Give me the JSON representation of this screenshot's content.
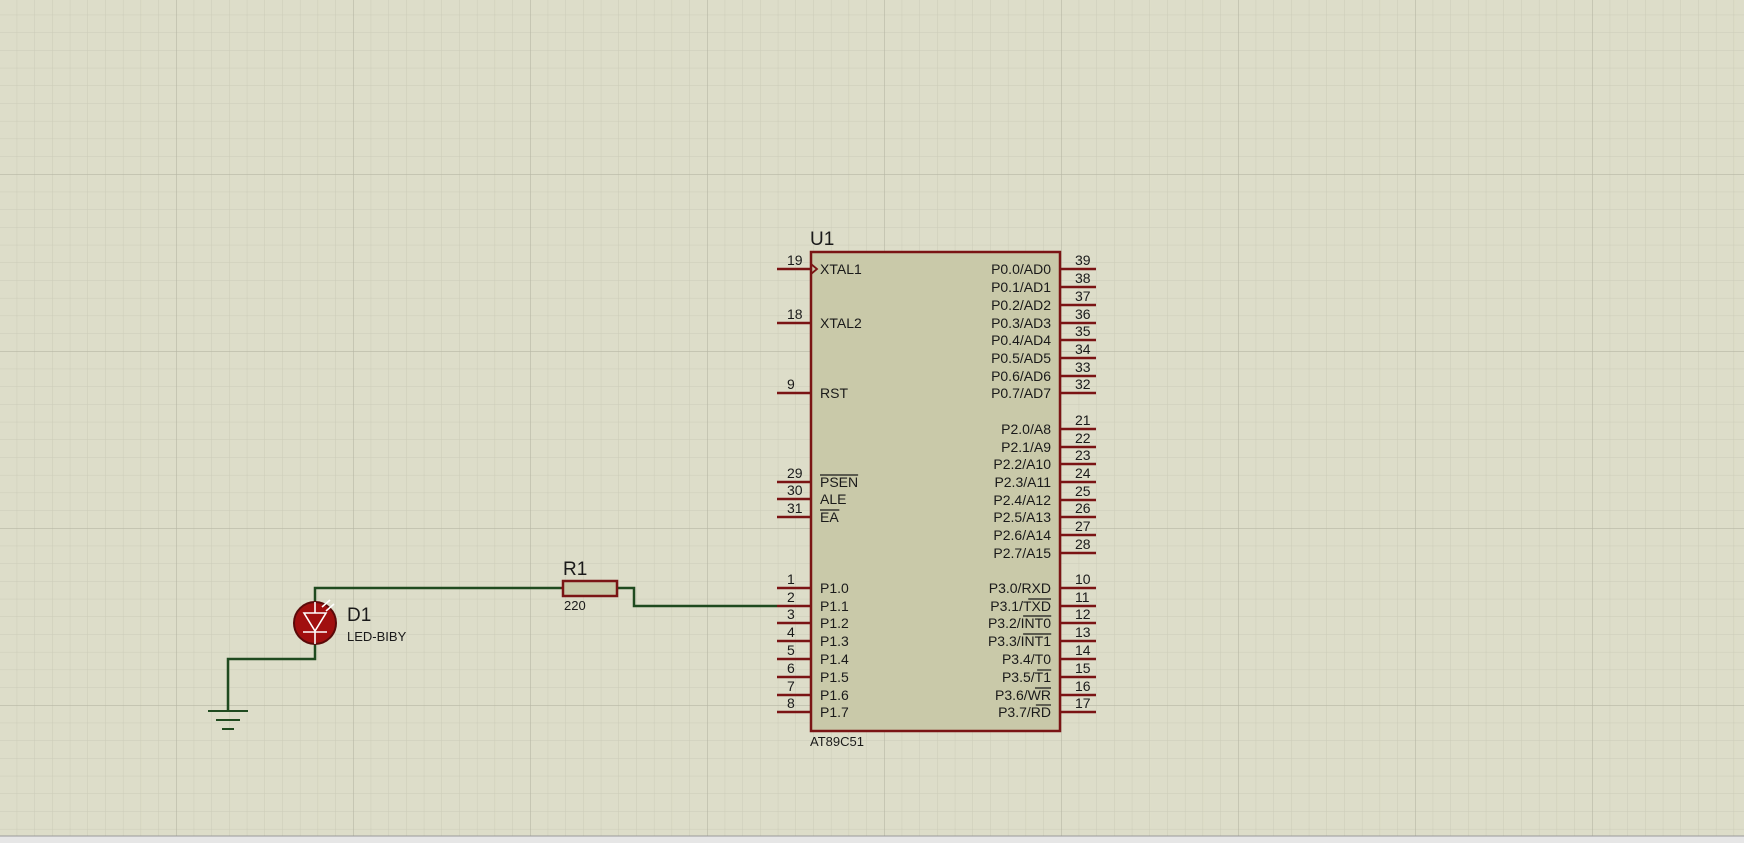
{
  "app": "Proteus ISIS schematic capture",
  "components": {
    "u1": {
      "ref": "U1",
      "part": "AT89C51",
      "left_pins": [
        {
          "num": "19",
          "name": "XTAL1",
          "clock": true
        },
        {
          "num": "18",
          "name": "XTAL2"
        },
        {
          "num": "9",
          "name": "RST"
        },
        {
          "num": "29",
          "name": "PSEN",
          "overbar": "PSEN"
        },
        {
          "num": "30",
          "name": "ALE"
        },
        {
          "num": "31",
          "name": "EA",
          "overbar": "EA"
        },
        {
          "num": "1",
          "name": "P1.0"
        },
        {
          "num": "2",
          "name": "P1.1"
        },
        {
          "num": "3",
          "name": "P1.2"
        },
        {
          "num": "4",
          "name": "P1.3"
        },
        {
          "num": "5",
          "name": "P1.4"
        },
        {
          "num": "6",
          "name": "P1.5"
        },
        {
          "num": "7",
          "name": "P1.6"
        },
        {
          "num": "8",
          "name": "P1.7"
        }
      ],
      "right_pins": [
        {
          "num": "39",
          "name": "P0.0/AD0"
        },
        {
          "num": "38",
          "name": "P0.1/AD1"
        },
        {
          "num": "37",
          "name": "P0.2/AD2"
        },
        {
          "num": "36",
          "name": "P0.3/AD3"
        },
        {
          "num": "35",
          "name": "P0.4/AD4"
        },
        {
          "num": "34",
          "name": "P0.5/AD5"
        },
        {
          "num": "33",
          "name": "P0.6/AD6"
        },
        {
          "num": "32",
          "name": "P0.7/AD7"
        },
        {
          "num": "21",
          "name": "P2.0/A8"
        },
        {
          "num": "22",
          "name": "P2.1/A9"
        },
        {
          "num": "23",
          "name": "P2.2/A10"
        },
        {
          "num": "24",
          "name": "P2.3/A11"
        },
        {
          "num": "25",
          "name": "P2.4/A12"
        },
        {
          "num": "26",
          "name": "P2.5/A13"
        },
        {
          "num": "27",
          "name": "P2.6/A14"
        },
        {
          "num": "28",
          "name": "P2.7/A15"
        },
        {
          "num": "10",
          "name": "P3.0/RXD"
        },
        {
          "num": "11",
          "name": "P3.1/TXD",
          "overbar": "TXD"
        },
        {
          "num": "12",
          "name": "P3.2/INT0",
          "overbar": "INT0"
        },
        {
          "num": "13",
          "name": "P3.3/INT1",
          "overbar": "INT1"
        },
        {
          "num": "14",
          "name": "P3.4/T0"
        },
        {
          "num": "15",
          "name": "P3.5/T1",
          "overbar": "T1"
        },
        {
          "num": "16",
          "name": "P3.6/WR",
          "overbar": "WR"
        },
        {
          "num": "17",
          "name": "P3.7/RD",
          "overbar": "RD"
        }
      ]
    },
    "r1": {
      "ref": "R1",
      "value": "220"
    },
    "d1": {
      "ref": "D1",
      "part": "LED-BIBY"
    }
  },
  "colors": {
    "background": "#ddddc9",
    "grid_minor": "#cfcfbc",
    "grid_major": "#bcbcab",
    "component_outline": "#7a1414",
    "component_fill": "#c9c9a9",
    "wire": "#1f4a1f",
    "led_fill": "#a10f0f"
  }
}
